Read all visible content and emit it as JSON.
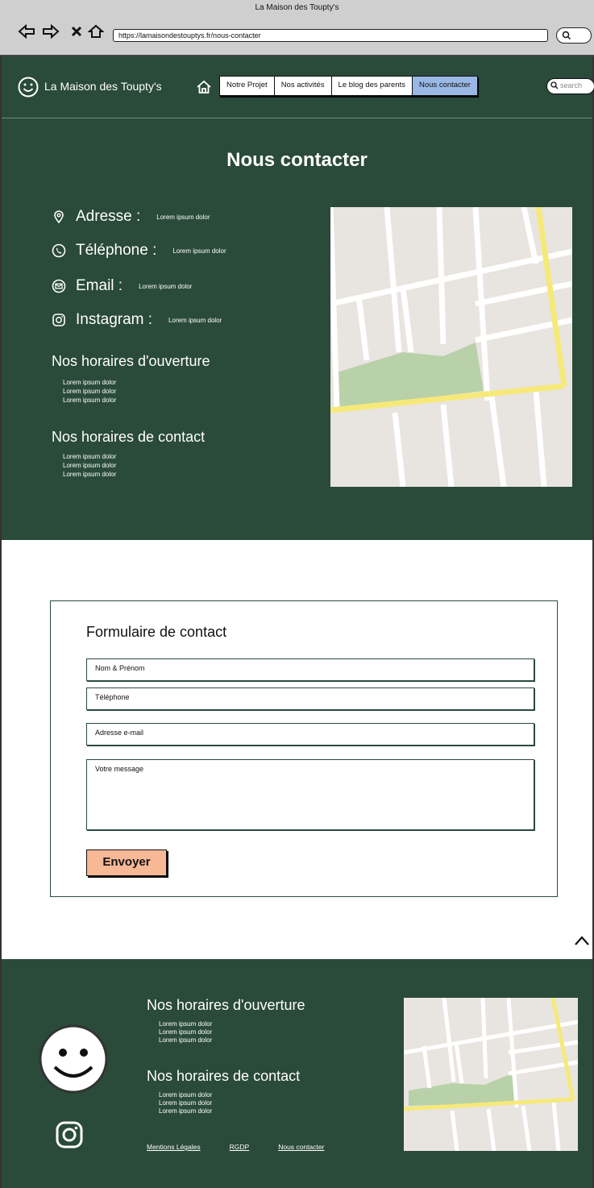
{
  "browser": {
    "window_title": "La Maison des Toupty's",
    "url": "https://lamaisondestouptys.fr/nous-contacter"
  },
  "header": {
    "logo_text": "La Maison des Toupty's",
    "menu": [
      "Notre Projet",
      "Nos activités",
      "Le blog des parents",
      "Nous contacter"
    ],
    "active_menu": "Nous contacter",
    "search_placeholder": "search"
  },
  "contact": {
    "title": "Nous contacter",
    "items": [
      {
        "label": "Adresse :",
        "value": "Lorem ipsum dolor",
        "icon": "location-pin-icon"
      },
      {
        "label": "Téléphone :",
        "value": "Lorem ipsum dolor",
        "icon": "phone-icon"
      },
      {
        "label": "Email :",
        "value": "Lorem ipsum dolor",
        "icon": "email-icon"
      },
      {
        "label": "Instagram :",
        "value": "Lorem ipsum dolor",
        "icon": "instagram-icon"
      }
    ],
    "opening_hours_title": "Nos horaires d'ouverture",
    "opening_hours": [
      "Lorem ipsum dolor",
      "Lorem ipsum dolor",
      "Lorem ipsum dolor"
    ],
    "contact_hours_title": "Nos horaires de contact",
    "contact_hours": [
      "Lorem ipsum dolor",
      "Lorem ipsum dolor",
      "Lorem ipsum dolor"
    ]
  },
  "form": {
    "title": "Formulaire de contact",
    "name_placeholder": "Nom & Prénom",
    "phone_placeholder": "Téléphone",
    "email_placeholder": "Adresse e-mail",
    "message_placeholder": "Votre message",
    "submit_label": "Envoyer"
  },
  "footer": {
    "opening_hours_title": "Nos horaires d'ouverture",
    "opening_hours": [
      "Lorem ipsum dolor",
      "Lorem ipsum dolor",
      "Lorem ipsum dolor"
    ],
    "contact_hours_title": "Nos horaires de contact",
    "contact_hours": [
      "Lorem ipsum dolor",
      "Lorem ipsum dolor",
      "Lorem ipsum dolor"
    ],
    "links": [
      "Mentions Légales",
      "RGDP",
      "Nous contacter"
    ]
  },
  "colors": {
    "brand_green": "#2a4a3a",
    "active_tab": "#9ab8e6",
    "submit_button": "#f7b896"
  }
}
